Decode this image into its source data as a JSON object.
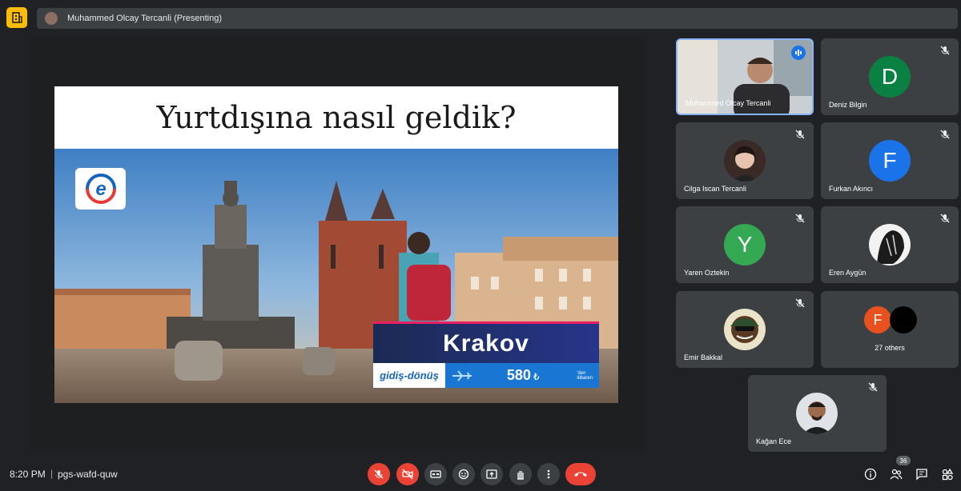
{
  "topbar": {
    "presenter_label": "Muhammed Olcay Tercanli (Presenting)"
  },
  "slide": {
    "title": "Yurtdışına nasıl geldik?",
    "logo_letter": "e",
    "promo_city": "Krakov",
    "promo_trip": "gidiş-dönüş",
    "promo_amount": "580",
    "promo_currency": "₺",
    "promo_note_1": "'den",
    "promo_note_2": "itibaren"
  },
  "participants": [
    {
      "name": "Muhammed Olcay Tercanli",
      "type": "video",
      "speaking": true
    },
    {
      "name": "Deniz Bilgin",
      "type": "letter",
      "letter": "D",
      "color": "#0b8043",
      "muted": true
    },
    {
      "name": "Cilga Iscan Tercanli",
      "type": "photo",
      "muted": true
    },
    {
      "name": "Furkan Akıncı",
      "type": "letter",
      "letter": "F",
      "color": "#1a73e8",
      "muted": true
    },
    {
      "name": "Yaren Oztekin",
      "type": "letter",
      "letter": "Y",
      "color": "#34a853",
      "muted": true
    },
    {
      "name": "Eren Aygün",
      "type": "photo",
      "muted": true
    },
    {
      "name": "Emir Bakkal",
      "type": "photo",
      "muted": true
    },
    {
      "name": "Kağan Ece",
      "type": "photo",
      "muted": true
    }
  ],
  "others": {
    "label": "27 others",
    "letter": "F",
    "color": "#e8501d"
  },
  "bottombar": {
    "time": "8:20 PM",
    "separator": "|",
    "meeting_code": "pgs-wafd-quw",
    "people_count": "36"
  },
  "colors": {
    "accent_yellow": "#fbbc04",
    "danger_red": "#ea4335",
    "tile_bg": "#3c4043",
    "speaking_blue": "#1a73e8"
  }
}
